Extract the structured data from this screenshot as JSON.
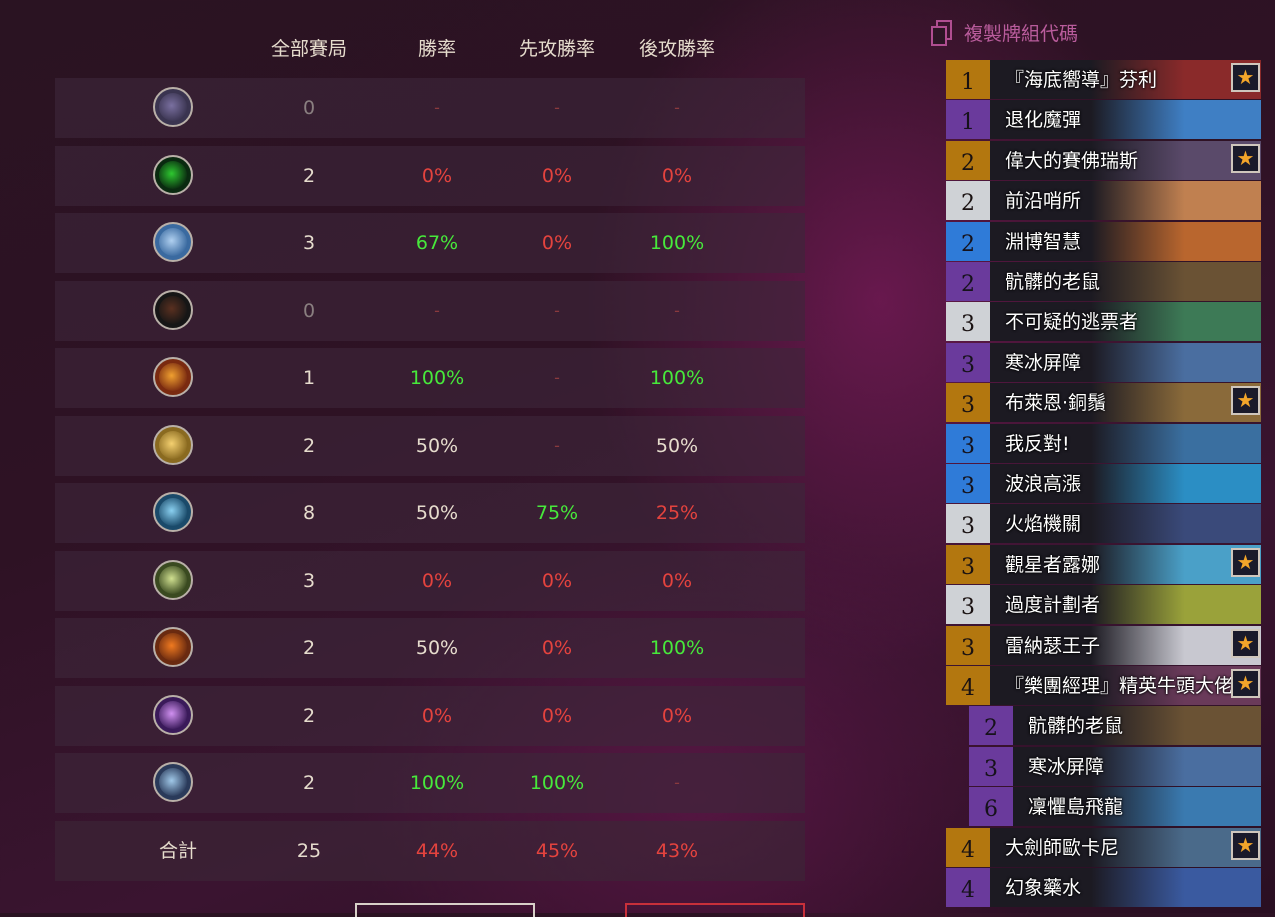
{
  "stats": {
    "headers": {
      "all_games": "全部賽局",
      "win_rate": "勝率",
      "first_win_rate": "先攻勝率",
      "second_win_rate": "後攻勝率"
    },
    "rows": [
      {
        "icon": "generic-class-icon",
        "games": "0",
        "win": "-",
        "first": "-",
        "second": "-"
      },
      {
        "icon": "hunter-class-icon",
        "games": "2",
        "win": "0%",
        "first": "0%",
        "second": "0%"
      },
      {
        "icon": "shaman-class-icon",
        "games": "3",
        "win": "67%",
        "first": "0%",
        "second": "100%"
      },
      {
        "icon": "demon-hunter-class-icon",
        "games": "0",
        "win": "-",
        "first": "-",
        "second": "-"
      },
      {
        "icon": "mage-class-icon",
        "games": "1",
        "win": "100%",
        "first": "-",
        "second": "100%"
      },
      {
        "icon": "paladin-class-icon",
        "games": "2",
        "win": "50%",
        "first": "-",
        "second": "50%"
      },
      {
        "icon": "priest-class-icon",
        "games": "8",
        "win": "50%",
        "first": "75%",
        "second": "25%"
      },
      {
        "icon": "druid-class-icon",
        "games": "3",
        "win": "0%",
        "first": "0%",
        "second": "0%"
      },
      {
        "icon": "warrior-class-icon",
        "games": "2",
        "win": "50%",
        "first": "0%",
        "second": "100%"
      },
      {
        "icon": "warlock-class-icon",
        "games": "2",
        "win": "0%",
        "first": "0%",
        "second": "0%"
      },
      {
        "icon": "rogue-class-icon",
        "games": "2",
        "win": "100%",
        "first": "100%",
        "second": "-"
      }
    ],
    "total": {
      "label": "合計",
      "games": "25",
      "win": "44%",
      "first": "45%",
      "second": "43%"
    }
  },
  "deck": {
    "copy_label": "複製牌組代碼",
    "cards": [
      {
        "cost": "1",
        "name": "『海底嚮導』芬利",
        "rarity": "legendary",
        "star": "★",
        "art": "#8a2a2a"
      },
      {
        "cost": "1",
        "name": "退化魔彈",
        "rarity": "epic",
        "art": "#3f7fc4"
      },
      {
        "cost": "2",
        "name": "偉大的賽佛瑞斯",
        "rarity": "legendary",
        "star": "★",
        "art": "#5a4a6a"
      },
      {
        "cost": "2",
        "name": "前沿哨所",
        "rarity": "common",
        "art": "#c08050"
      },
      {
        "cost": "2",
        "name": "淵博智慧",
        "rarity": "rare",
        "art": "#b9662e"
      },
      {
        "cost": "2",
        "name": "骯髒的老鼠",
        "rarity": "epic",
        "art": "#6a5234"
      },
      {
        "cost": "3",
        "name": "不可疑的逃票者",
        "rarity": "common",
        "art": "#3d7a56"
      },
      {
        "cost": "3",
        "name": "寒冰屏障",
        "rarity": "epic",
        "art": "#4a6ea0"
      },
      {
        "cost": "3",
        "name": "布萊恩·銅鬚",
        "rarity": "legendary",
        "star": "★",
        "art": "#8a6a3a"
      },
      {
        "cost": "3",
        "name": "我反對!",
        "rarity": "rare",
        "art": "#3a6fa0"
      },
      {
        "cost": "3",
        "name": "波浪高漲",
        "rarity": "rare",
        "art": "#2b8ec4"
      },
      {
        "cost": "3",
        "name": "火焰機關",
        "rarity": "common",
        "art": "#3a4a7a"
      },
      {
        "cost": "3",
        "name": "觀星者露娜",
        "rarity": "legendary",
        "star": "★",
        "art": "#4aa0c8"
      },
      {
        "cost": "3",
        "name": "過度計劃者",
        "rarity": "common",
        "art": "#9aa23a"
      },
      {
        "cost": "3",
        "name": "雷納瑟王子",
        "rarity": "legendary",
        "star": "★",
        "art": "#c8c8d0"
      },
      {
        "cost": "4",
        "name": "『樂團經理』精英牛頭大佬",
        "rarity": "legendary",
        "star": "★",
        "art": "#6a3a5a"
      },
      {
        "cost": "2",
        "name": "骯髒的老鼠",
        "rarity": "epic",
        "child": true,
        "art": "#6a5234"
      },
      {
        "cost": "3",
        "name": "寒冰屏障",
        "rarity": "epic",
        "child": true,
        "art": "#4a6ea0"
      },
      {
        "cost": "6",
        "name": "凜懼島飛龍",
        "rarity": "epic",
        "child": true,
        "art": "#3a7ab0"
      },
      {
        "cost": "4",
        "name": "大劍師歐卡尼",
        "rarity": "legendary",
        "star": "★",
        "art": "#4a6a8a"
      },
      {
        "cost": "4",
        "name": "幻象藥水",
        "rarity": "epic",
        "art": "#3a5aa0"
      }
    ]
  },
  "colors": {
    "green": "#47e93b",
    "red": "#e4433e",
    "legendary": "#b3770f",
    "epic": "#6a3a9c",
    "rare": "#2f7bd8",
    "common": "#cfd2d6"
  }
}
